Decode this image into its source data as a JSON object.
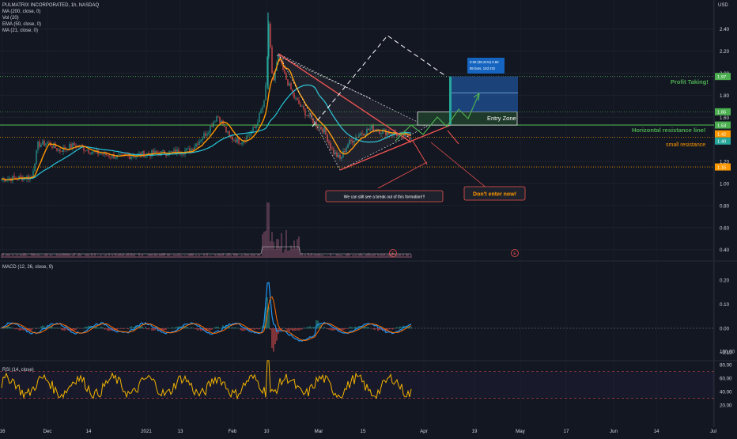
{
  "header": {
    "symbol": "PULMATRIX INCORPORATED, 1h, NASDAQ",
    "indicators": [
      "MA (200, close, 0)",
      "Vol (20)",
      "EMA (50, close, 0)",
      "MA (21, close, 0)"
    ],
    "currency": "USD"
  },
  "chart_data": {
    "type": "line",
    "price_axis": {
      "ticks": [
        "2.40",
        "2.20",
        "2.00",
        "1.80",
        "1.60",
        "1.20",
        "1.00",
        "0.80",
        "0.60",
        "0.40"
      ],
      "ylim": [
        0.3,
        2.55
      ]
    },
    "x_axis": {
      "labels": [
        "16",
        "Dec",
        "14",
        "2021",
        "13",
        "Feb",
        "10",
        "Mar",
        "15",
        "Apr",
        "19",
        "May",
        "17",
        "Jun",
        "14",
        "Jul"
      ]
    },
    "price_labels": [
      {
        "value": "1.97",
        "color": "#4caf50"
      },
      {
        "value": "1.65",
        "color": "#4caf50"
      },
      {
        "value": "1.53",
        "color": "#4caf50"
      },
      {
        "value": "1.42",
        "color": "#ff9800"
      },
      {
        "value": "1.40",
        "color": "#26a69a"
      },
      {
        "value": "1.15",
        "color": "#ff9800"
      }
    ],
    "levels": {
      "profit_taking": 1.97,
      "entry_top": 1.65,
      "entry_bottom": 1.53,
      "horizontal_resistance": 1.53,
      "small_resistance": 1.42,
      "support": 1.15
    },
    "position_tool": {
      "line1": "0.50 (35.21%) 0.50",
      "line2": "85 bars, 12d 21h"
    },
    "annotations": {
      "profit_taking": "Profit Taking!",
      "entry_zone": "Entry Zone",
      "horizontal_resistance": "Horizontal resistance line!",
      "small_resistance": "small resistance",
      "breakout_note": "We can still see a break out of this formation!!!",
      "dont_enter": "Don't enter now!"
    },
    "earnings_markers": [
      "E",
      "E"
    ],
    "macd": {
      "title": "MACD (12, 26, close, 9)",
      "ticks": [
        "0.20",
        "0.10",
        "0.00",
        "−0.10"
      ],
      "ylim": [
        -0.14,
        0.26
      ]
    },
    "rsi": {
      "title": "RSI (14, close)",
      "ticks": [
        "100.00",
        "80.00",
        "60.00",
        "40.00",
        "20.00"
      ],
      "ylim": [
        0,
        100
      ],
      "bands": [
        70,
        30
      ]
    },
    "colors": {
      "background": "#131722",
      "up": "#26a69a",
      "down": "#ef5350",
      "ema50": "#26c6da",
      "ma21": "#ff9800",
      "volume": "#f48fb1",
      "macd": "#2196f3",
      "signal": "#ff6d00",
      "rsi": "#f4b400",
      "green": "#4caf50",
      "orange": "#ff9800",
      "red": "#e53935"
    }
  }
}
